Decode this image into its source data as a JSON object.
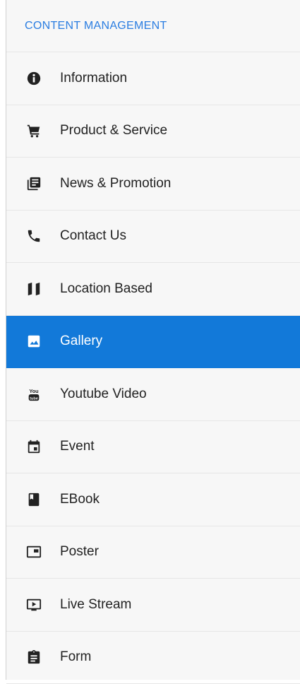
{
  "sidebar": {
    "section_title": "CONTENT MANAGEMENT",
    "accent_color": "#1279d9",
    "items": [
      {
        "label": "Information",
        "icon": "info-circle-icon"
      },
      {
        "label": "Product & Service",
        "icon": "cart-icon"
      },
      {
        "label": "News & Promotion",
        "icon": "news-icon"
      },
      {
        "label": "Contact Us",
        "icon": "phone-icon"
      },
      {
        "label": "Location Based",
        "icon": "map-icon"
      },
      {
        "label": "Gallery",
        "icon": "image-icon",
        "active": true
      },
      {
        "label": "Youtube Video",
        "icon": "youtube-icon"
      },
      {
        "label": "Event",
        "icon": "calendar-icon"
      },
      {
        "label": "EBook",
        "icon": "book-icon"
      },
      {
        "label": "Poster",
        "icon": "poster-icon"
      },
      {
        "label": "Live Stream",
        "icon": "live-stream-icon"
      },
      {
        "label": "Form",
        "icon": "clipboard-icon"
      }
    ]
  }
}
